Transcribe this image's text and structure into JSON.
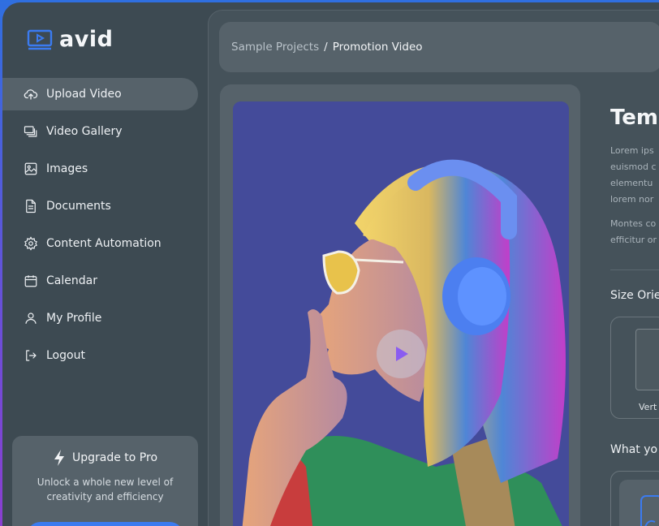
{
  "app": {
    "name": "avid",
    "brand_color": "#3b7bf0"
  },
  "sidebar": {
    "items": [
      {
        "label": "Upload Video",
        "icon": "upload-cloud-icon",
        "active": true
      },
      {
        "label": "Video Gallery",
        "icon": "gallery-icon",
        "active": false
      },
      {
        "label": "Images",
        "icon": "image-icon",
        "active": false
      },
      {
        "label": "Documents",
        "icon": "document-icon",
        "active": false
      },
      {
        "label": "Content Automation",
        "icon": "gear-icon",
        "active": false
      },
      {
        "label": "Calendar",
        "icon": "calendar-icon",
        "active": false
      },
      {
        "label": "My Profile",
        "icon": "user-icon",
        "active": false
      },
      {
        "label": "Logout",
        "icon": "logout-icon",
        "active": false
      }
    ],
    "upgrade": {
      "title": "Upgrade to Pro",
      "description": "Unlock a whole new level of creativity and efficiency"
    }
  },
  "breadcrumb": {
    "parent": "Sample Projects",
    "separator": "/",
    "current": "Promotion Video"
  },
  "details": {
    "title": "Tem",
    "text1": [
      "Lorem ips",
      "euismod c",
      "elementu",
      "lorem nor"
    ],
    "text2": [
      "Montes co",
      "efficitur or"
    ],
    "size_label": "Size Orie",
    "size_caption": "Vert",
    "what_label": "What yo"
  }
}
